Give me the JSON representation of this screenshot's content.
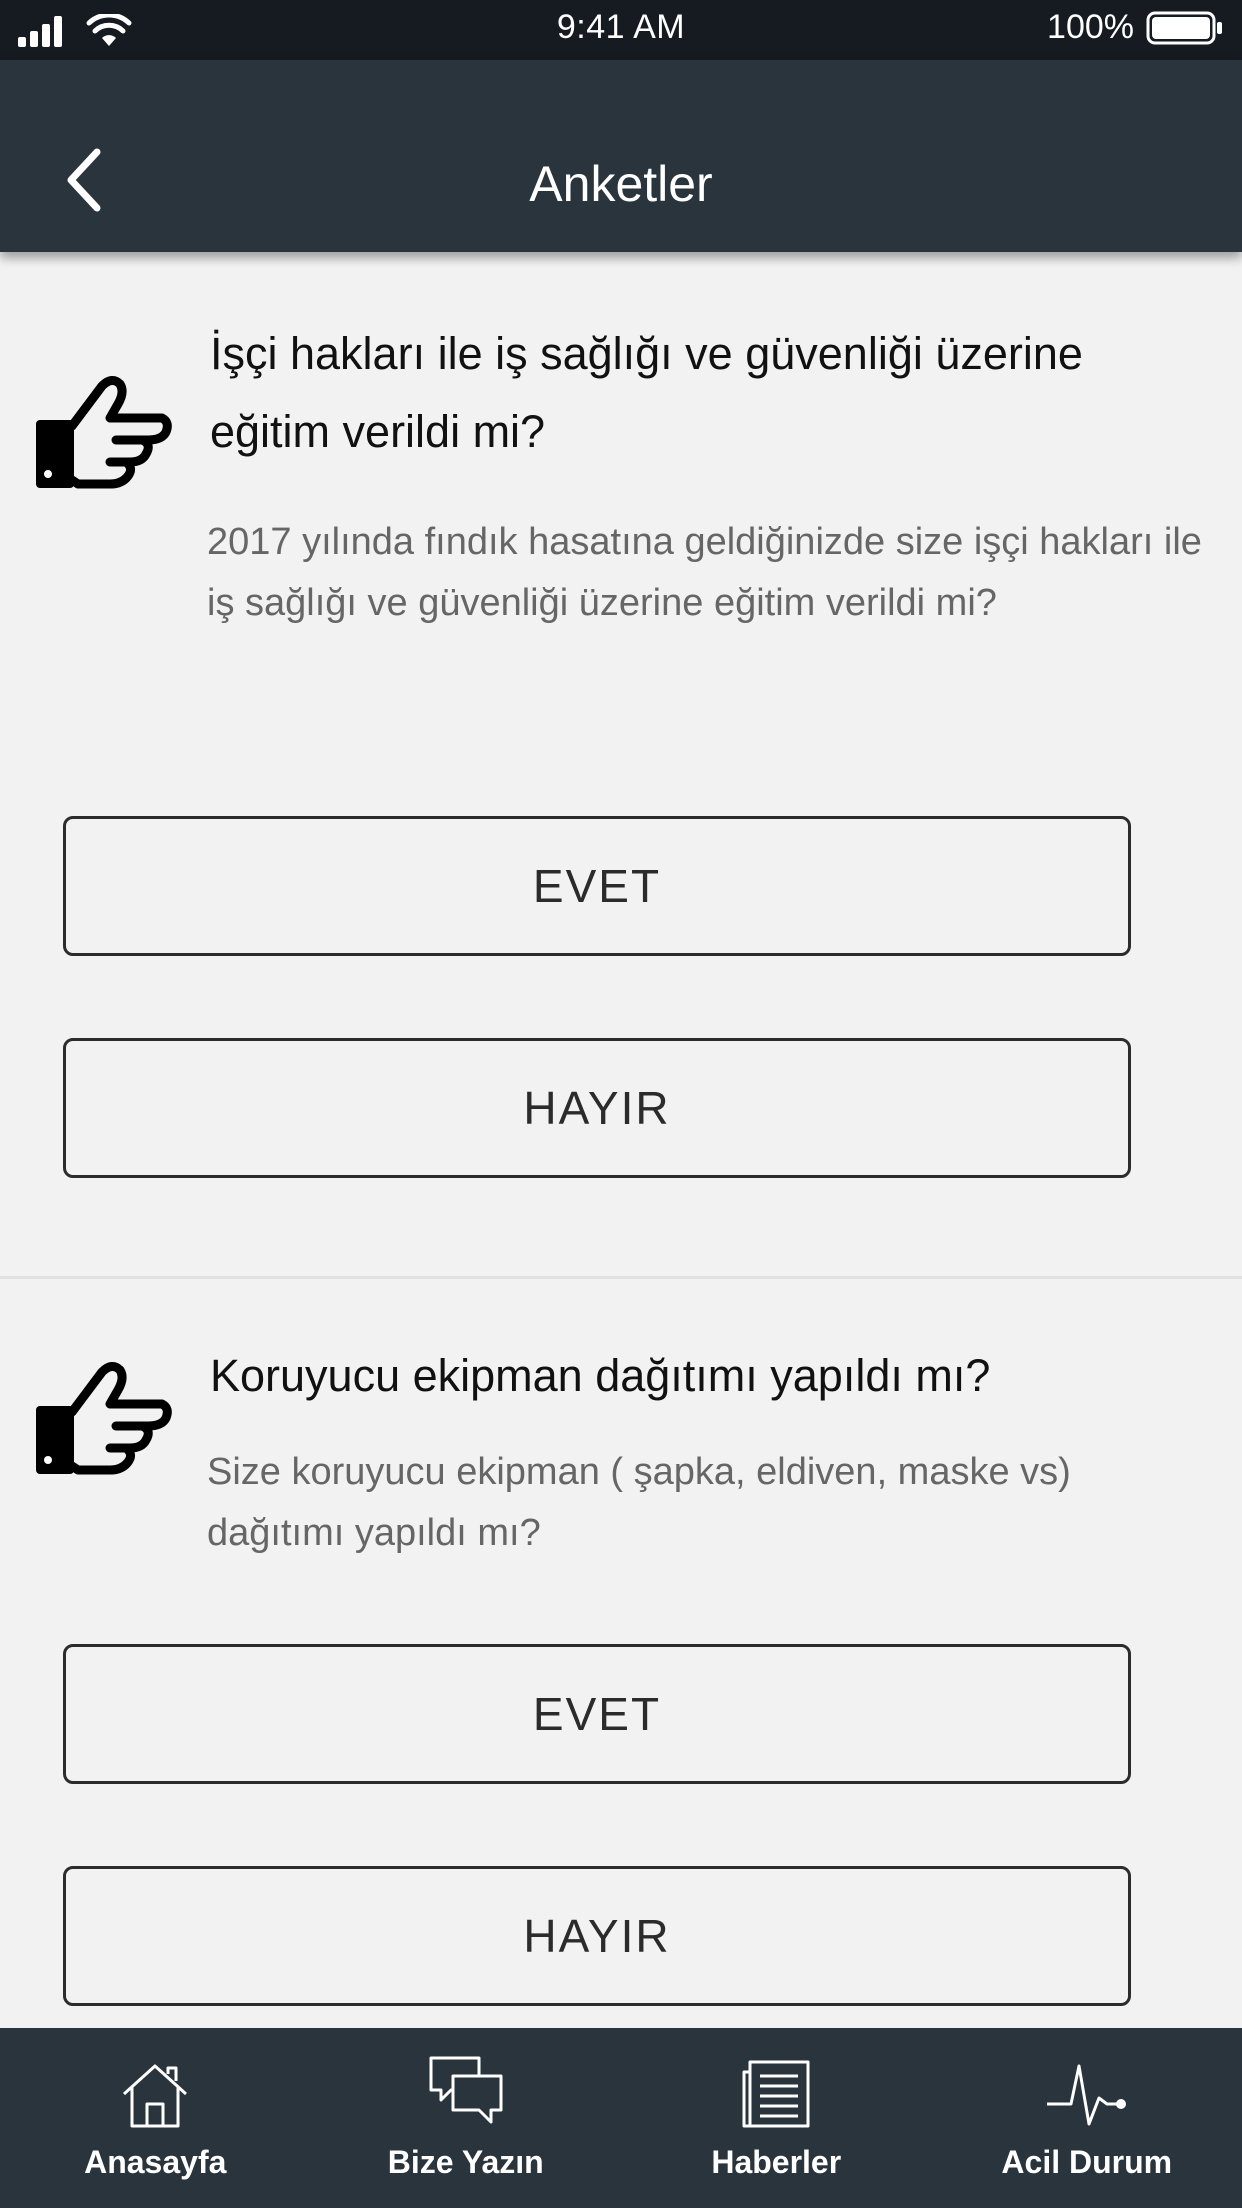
{
  "status_bar": {
    "time": "9:41 AM",
    "battery": "100%",
    "icons": [
      "signal-icon",
      "wifi-icon",
      "battery-icon"
    ]
  },
  "nav": {
    "title": "Anketler",
    "back_icon": "chevron-left-icon"
  },
  "surveys": [
    {
      "icon": "pointing-hand-icon",
      "title": "İşçi hakları ile iş sağlığı ve güvenliği üzerine eğitim verildi mi?",
      "description": "2017 yılında fındık hasatına geldiğinizde size işçi hakları ile iş sağlığı ve güvenliği üzerine eğitim verildi mi?",
      "yes_label": "EVET",
      "no_label": "HAYIR"
    },
    {
      "icon": "pointing-hand-icon",
      "title": "Koruyucu ekipman dağıtımı yapıldı mı?",
      "description": "Size koruyucu ekipman ( şapka, eldiven, maske vs) dağıtımı yapıldı mı?",
      "yes_label": "EVET",
      "no_label": "HAYIR"
    }
  ],
  "tab_bar": {
    "tabs": [
      {
        "label": "Anasayfa",
        "icon": "home-icon"
      },
      {
        "label": "Bize Yazın",
        "icon": "chat-bubbles-icon"
      },
      {
        "label": "Haberler",
        "icon": "news-icon"
      },
      {
        "label": "Acil Durum",
        "icon": "heartbeat-icon"
      }
    ]
  },
  "colors": {
    "header_bg": "#29343c",
    "status_bg": "#151b20",
    "page_bg": "#f2f2f2",
    "button_border": "#2c2c2c",
    "description_text": "#666666"
  }
}
